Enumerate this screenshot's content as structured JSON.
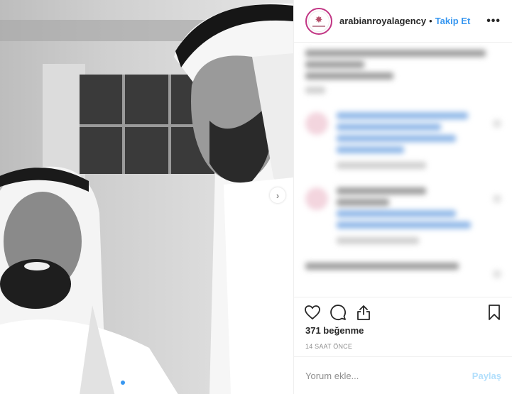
{
  "post": {
    "photo_alt": "",
    "carousel_dots": 4,
    "active_dot": 0
  },
  "header": {
    "username": "arabianroyalagency",
    "separator": "•",
    "follow_label": "Takip Et",
    "more_label": "•••"
  },
  "stats": {
    "likes": "371 beğenme",
    "time": "14 SAAT ÖNCE"
  },
  "comment_box": {
    "placeholder": "Yorum ekle...",
    "post_label": "Paylaş"
  },
  "icons": {
    "like": "heart-icon",
    "comment": "comment-icon",
    "share": "share-icon",
    "save": "bookmark-icon",
    "next": "chevron-right-icon"
  },
  "colors": {
    "accent": "#3897f0",
    "post_disabled": "#b2dffc",
    "avatar_ring": "#c13584"
  }
}
